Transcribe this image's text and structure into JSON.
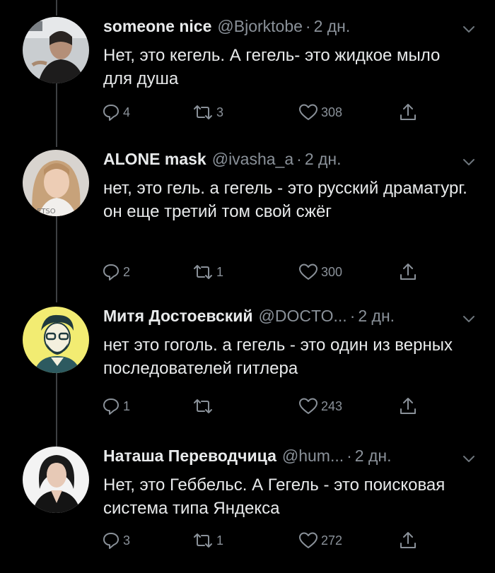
{
  "tweets": [
    {
      "name": "someone nice",
      "handle": "@Bjorktobe",
      "dot": "·",
      "time": "2 дн.",
      "text": "Нет, это кегель. А гегель- это жидкое мыло для душа",
      "replies": "4",
      "retweets": "3",
      "likes": "308"
    },
    {
      "name": "ALONE mask",
      "handle": "@ivasha_a",
      "dot": "·",
      "time": "2 дн.",
      "text": "нет, это гель. а гегель - это русский драматург. он еще третий том свой сжёг",
      "replies": "2",
      "retweets": "1",
      "likes": "300"
    },
    {
      "name": "Митя Достоевский",
      "handle": "@DOCTO...",
      "dot": "·",
      "time": "2 дн.",
      "text": "нет это гоголь. а гегель - это один из верных последователей гитлера",
      "replies": "1",
      "retweets": "",
      "likes": "243"
    },
    {
      "name": "Наташа Переводчица",
      "handle": "@hum...",
      "dot": "·",
      "time": "2 дн.",
      "text": "Нет, это Геббельс. А Гегель - это поисковая система типа Яндекса",
      "replies": "3",
      "retweets": "1",
      "likes": "272"
    }
  ],
  "icons": {
    "reply": "reply-icon",
    "retweet": "retweet-icon",
    "like": "heart-icon",
    "share": "share-icon",
    "more": "chevron-down-icon"
  },
  "colors": {
    "background": "#000000",
    "text": "#e8eaeb",
    "secondary": "#8a9199",
    "thread_line": "#3d4043",
    "avatar_yellow": "#f2ec72"
  }
}
